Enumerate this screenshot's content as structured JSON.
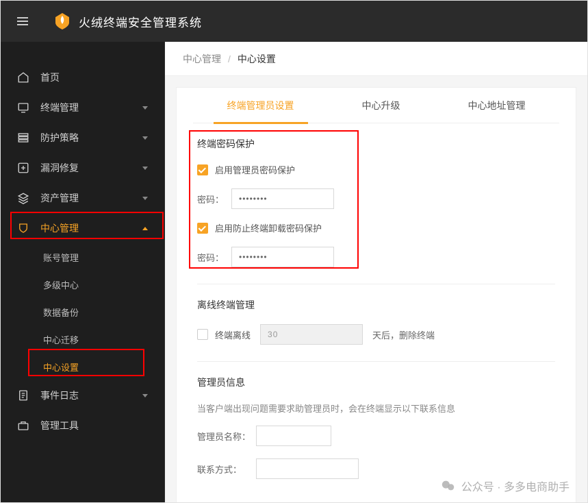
{
  "header": {
    "app_title": "火绒终端安全管理系统"
  },
  "sidebar": {
    "items": [
      {
        "label": "首页",
        "icon": "home-icon",
        "expandable": false
      },
      {
        "label": "终端管理",
        "icon": "monitor-icon",
        "expandable": true
      },
      {
        "label": "防护策略",
        "icon": "stack-icon",
        "expandable": true
      },
      {
        "label": "漏洞修复",
        "icon": "plus-box-icon",
        "expandable": true
      },
      {
        "label": "资产管理",
        "icon": "layers-icon",
        "expandable": true
      },
      {
        "label": "中心管理",
        "icon": "shield-icon",
        "expandable": true,
        "active": true,
        "sub": [
          {
            "label": "账号管理"
          },
          {
            "label": "多级中心"
          },
          {
            "label": "数据备份"
          },
          {
            "label": "中心迁移"
          },
          {
            "label": "中心设置",
            "active": true
          }
        ]
      },
      {
        "label": "事件日志",
        "icon": "clipboard-icon",
        "expandable": true
      },
      {
        "label": "管理工具",
        "icon": "toolbox-icon",
        "expandable": false
      }
    ]
  },
  "breadcrumb": {
    "parent": "中心管理",
    "separator": "/",
    "current": "中心设置"
  },
  "tabs": [
    {
      "label": "终端管理员设置",
      "active": true
    },
    {
      "label": "中心升级"
    },
    {
      "label": "中心地址管理"
    }
  ],
  "sections": {
    "password_protection": {
      "title": "终端密码保护",
      "admin_checkbox_label": "启用管理员密码保护",
      "admin_checked": true,
      "admin_pw_label": "密码：",
      "admin_pw_value": "••••••••",
      "uninstall_checkbox_label": "启用防止终端卸载密码保护",
      "uninstall_checked": true,
      "uninstall_pw_label": "密码：",
      "uninstall_pw_value": "••••••••"
    },
    "offline_mgmt": {
      "title": "离线终端管理",
      "checkbox_label": "终端离线",
      "checked": false,
      "days_value": "30",
      "trailing": "天后，删除终端"
    },
    "admin_info": {
      "title": "管理员信息",
      "help": "当客户端出现问题需要求助管理员时，会在终端显示以下联系信息",
      "name_label": "管理员名称：",
      "name_value": "",
      "contact_label": "联系方式：",
      "contact_value": ""
    }
  },
  "watermark": {
    "text": "公众号 · 多多电商助手"
  }
}
